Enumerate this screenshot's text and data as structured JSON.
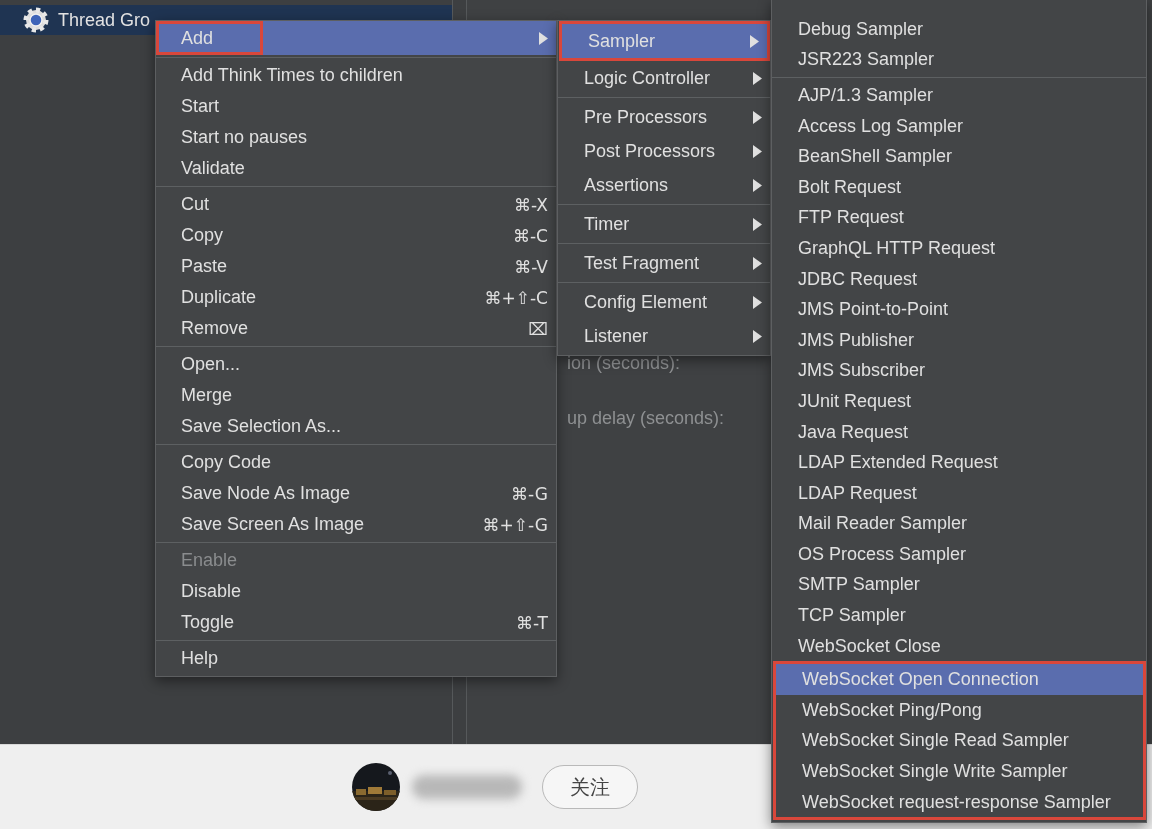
{
  "tree": {
    "items": [
      {
        "label": "Thread Gro",
        "selected": true
      }
    ]
  },
  "form": {
    "labels": [
      "ion (seconds):",
      "up delay (seconds):"
    ]
  },
  "context_menu": {
    "sections": [
      {
        "items": [
          {
            "label": "Add",
            "selected": true,
            "disabled": false,
            "outlined": true,
            "has_submenu": true
          }
        ]
      },
      {
        "items": [
          {
            "label": "Add Think Times to children",
            "selected": false,
            "disabled": false,
            "outlined": false,
            "has_submenu": false
          },
          {
            "label": "Start",
            "selected": false,
            "disabled": false,
            "outlined": false,
            "has_submenu": false
          },
          {
            "label": "Start no pauses",
            "selected": false,
            "disabled": false,
            "outlined": false,
            "has_submenu": false
          },
          {
            "label": "Validate",
            "selected": false,
            "disabled": false,
            "outlined": false,
            "has_submenu": false
          }
        ]
      },
      {
        "items": [
          {
            "label": "Cut",
            "shortcut": "⌘-X",
            "selected": false,
            "disabled": false,
            "outlined": false,
            "has_submenu": false
          },
          {
            "label": "Copy",
            "shortcut": "⌘-C",
            "selected": false,
            "disabled": false,
            "outlined": false,
            "has_submenu": false
          },
          {
            "label": "Paste",
            "shortcut": "⌘-V",
            "selected": false,
            "disabled": false,
            "outlined": false,
            "has_submenu": false
          },
          {
            "label": "Duplicate",
            "shortcut": "⌘+⇧-C",
            "selected": false,
            "disabled": false,
            "outlined": false,
            "has_submenu": false
          },
          {
            "label": "Remove",
            "shortcut": "⌧",
            "selected": false,
            "disabled": false,
            "outlined": false,
            "has_submenu": false
          }
        ]
      },
      {
        "items": [
          {
            "label": "Open...",
            "selected": false,
            "disabled": false,
            "outlined": false,
            "has_submenu": false
          },
          {
            "label": "Merge",
            "selected": false,
            "disabled": false,
            "outlined": false,
            "has_submenu": false
          },
          {
            "label": "Save Selection As...",
            "selected": false,
            "disabled": false,
            "outlined": false,
            "has_submenu": false
          }
        ]
      },
      {
        "items": [
          {
            "label": "Copy Code",
            "selected": false,
            "disabled": false,
            "outlined": false,
            "has_submenu": false
          },
          {
            "label": "Save Node As Image",
            "shortcut": "⌘-G",
            "selected": false,
            "disabled": false,
            "outlined": false,
            "has_submenu": false
          },
          {
            "label": "Save Screen As Image",
            "shortcut": "⌘+⇧-G",
            "selected": false,
            "disabled": false,
            "outlined": false,
            "has_submenu": false
          }
        ]
      },
      {
        "items": [
          {
            "label": "Enable",
            "selected": false,
            "disabled": true,
            "outlined": false,
            "has_submenu": false
          },
          {
            "label": "Disable",
            "selected": false,
            "disabled": false,
            "outlined": false,
            "has_submenu": false
          },
          {
            "label": "Toggle",
            "shortcut": "⌘-T",
            "selected": false,
            "disabled": false,
            "outlined": false,
            "has_submenu": false
          }
        ]
      },
      {
        "items": [
          {
            "label": "Help",
            "selected": false,
            "disabled": false,
            "outlined": false,
            "has_submenu": false
          }
        ]
      }
    ]
  },
  "add_menu": {
    "sections": [
      {
        "items": [
          {
            "label": "Sampler",
            "selected": true,
            "outlined": true
          },
          {
            "label": "Logic Controller",
            "selected": false,
            "outlined": false
          }
        ]
      },
      {
        "items": [
          {
            "label": "Pre Processors",
            "selected": false,
            "outlined": false
          },
          {
            "label": "Post Processors",
            "selected": false,
            "outlined": false
          },
          {
            "label": "Assertions",
            "selected": false,
            "outlined": false
          }
        ]
      },
      {
        "items": [
          {
            "label": "Timer",
            "selected": false,
            "outlined": false
          }
        ]
      },
      {
        "items": [
          {
            "label": "Test Fragment",
            "selected": false,
            "outlined": false
          }
        ]
      },
      {
        "items": [
          {
            "label": "Config Element",
            "selected": false,
            "outlined": false
          },
          {
            "label": "Listener",
            "selected": false,
            "outlined": false
          }
        ]
      }
    ]
  },
  "sampler_menu": {
    "sections": [
      {
        "items": [
          {
            "label": "Debug Sampler",
            "selected": false,
            "outlined": false
          },
          {
            "label": "JSR223 Sampler",
            "selected": false,
            "outlined": false
          }
        ]
      },
      {
        "items": [
          {
            "label": "AJP/1.3 Sampler",
            "selected": false,
            "outlined": false
          },
          {
            "label": "Access Log Sampler",
            "selected": false,
            "outlined": false
          },
          {
            "label": "BeanShell Sampler",
            "selected": false,
            "outlined": false
          },
          {
            "label": "Bolt Request",
            "selected": false,
            "outlined": false
          },
          {
            "label": "FTP Request",
            "selected": false,
            "outlined": false
          },
          {
            "label": "GraphQL HTTP Request",
            "selected": false,
            "outlined": false
          },
          {
            "label": "JDBC Request",
            "selected": false,
            "outlined": false
          },
          {
            "label": "JMS Point-to-Point",
            "selected": false,
            "outlined": false
          },
          {
            "label": "JMS Publisher",
            "selected": false,
            "outlined": false
          },
          {
            "label": "JMS Subscriber",
            "selected": false,
            "outlined": false
          },
          {
            "label": "JUnit Request",
            "selected": false,
            "outlined": false
          },
          {
            "label": "Java Request",
            "selected": false,
            "outlined": false
          },
          {
            "label": "LDAP Extended Request",
            "selected": false,
            "outlined": false
          },
          {
            "label": "LDAP Request",
            "selected": false,
            "outlined": false
          },
          {
            "label": "Mail Reader Sampler",
            "selected": false,
            "outlined": false
          },
          {
            "label": "OS Process Sampler",
            "selected": false,
            "outlined": false
          },
          {
            "label": "SMTP Sampler",
            "selected": false,
            "outlined": false
          },
          {
            "label": "TCP Sampler",
            "selected": false,
            "outlined": false
          },
          {
            "label": "WebSocket Close",
            "selected": false,
            "outlined": false
          },
          {
            "label": "WebSocket Open Connection",
            "selected": true,
            "outlined": true
          },
          {
            "label": "WebSocket Ping/Pong",
            "selected": false,
            "outlined": true
          },
          {
            "label": "WebSocket Single Read Sampler",
            "selected": false,
            "outlined": true
          },
          {
            "label": "WebSocket Single Write Sampler",
            "selected": false,
            "outlined": true
          },
          {
            "label": "WebSocket request-response Sampler",
            "selected": false,
            "outlined": true
          }
        ]
      }
    ]
  },
  "footer": {
    "follow_button": "关注"
  }
}
